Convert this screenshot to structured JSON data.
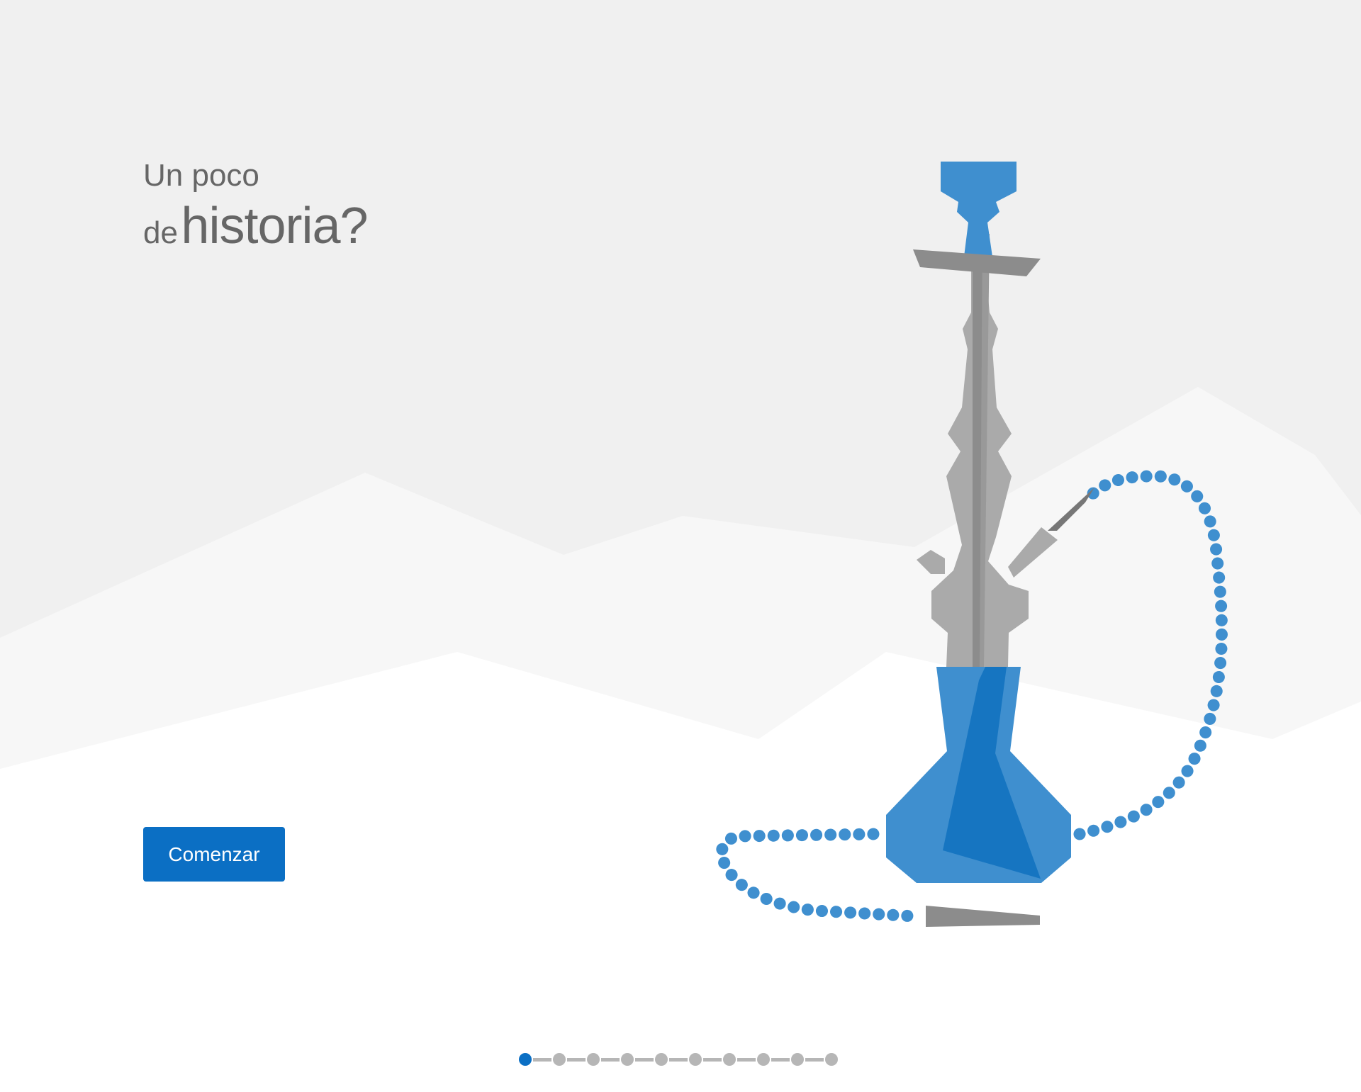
{
  "headline": {
    "line1": "Un poco",
    "line2_small": "de",
    "line2_big": "historia?"
  },
  "start_button": {
    "label": "Comenzar"
  },
  "pager": {
    "total": 10,
    "active": 0
  },
  "colors": {
    "background": "#f0f0f0",
    "mountain_light": "#f7f7f7",
    "ground": "#ffffff",
    "accent_blue": "#0b6fc4",
    "hookah_blue": "#3f8fcf",
    "hookah_gray": "#aaaaaa",
    "text_gray": "#666666"
  },
  "illustration": {
    "icon": "hookah-icon"
  }
}
